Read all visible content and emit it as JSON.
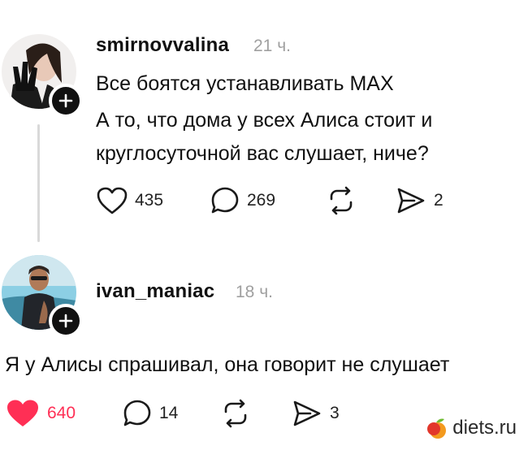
{
  "post1": {
    "username": "smirnovvalina",
    "time": "21 ч.",
    "lines": [
      "Все боятся устанавливать MAX",
      "А то, что дома у всех Алиса стоит и",
      "круглосуточной вас слушает, ниче?"
    ],
    "likes": "435",
    "comments": "269",
    "shares": "2",
    "liked": false
  },
  "post2": {
    "username": "ivan_maniac",
    "time": "18 ч.",
    "lines": [
      "Я у Алисы спрашивал, она говорит не слушает"
    ],
    "likes": "640",
    "comments": "14",
    "shares": "3",
    "liked": true
  },
  "watermark": {
    "text": "diets.ru"
  },
  "colors": {
    "like_active": "#ff2f55",
    "icon": "#1a1a1a",
    "muted": "#a0a0a0"
  },
  "icons": [
    "heart-icon",
    "comment-icon",
    "repost-icon",
    "share-icon",
    "plus-icon"
  ]
}
